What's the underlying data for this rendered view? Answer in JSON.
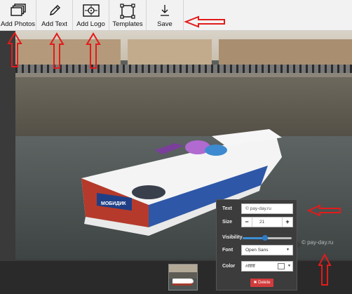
{
  "toolbar": {
    "items": [
      {
        "label": "Add Photos",
        "icon": "photos-stack-icon"
      },
      {
        "label": "Add Text",
        "icon": "pencil-icon"
      },
      {
        "label": "Add Logo",
        "icon": "logo-frame-icon"
      },
      {
        "label": "Templates",
        "icon": "templates-icon"
      },
      {
        "label": "Save",
        "icon": "download-icon"
      }
    ]
  },
  "photo": {
    "watermark_text": "© pay-day.ru",
    "boat_sign": "МОБИДИК"
  },
  "text_panel": {
    "text_label": "Text",
    "text_value": "© pay-day.ru",
    "size_label": "Size",
    "size_minus": "−",
    "size_value": "21",
    "size_plus": "+",
    "visibility_label": "Visibility",
    "visibility_value": 0.45,
    "font_label": "Font",
    "font_value": "Open Sans",
    "color_label": "Color",
    "color_value": "#ffffff",
    "delete_label": "✖ Delete"
  },
  "colors": {
    "annotation_arrow": "#e31b1b",
    "delete_button": "#d23c3c",
    "slider_accent": "#3d8fd6"
  }
}
